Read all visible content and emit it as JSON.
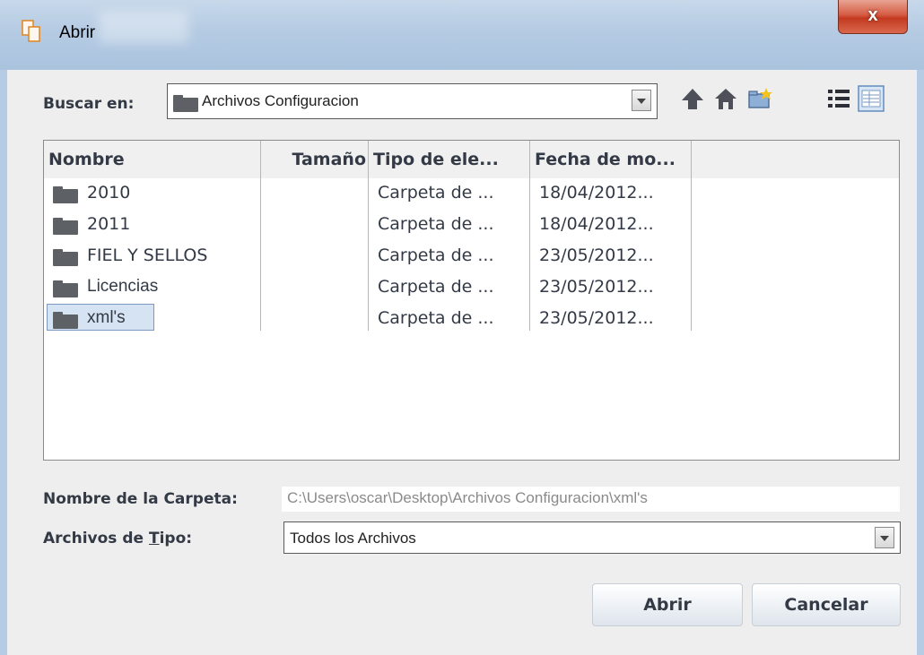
{
  "window": {
    "title": "Abrir",
    "close_label": "x"
  },
  "lookin": {
    "label": "Buscar en:",
    "value": "Archivos Configuracion"
  },
  "toolbar": {
    "up": "up-arrow-icon",
    "home": "home-icon",
    "new_folder": "new-folder-icon",
    "list_view": "list-view-icon",
    "details_view": "details-view-icon"
  },
  "columns": [
    "Nombre",
    "Tamaño",
    "Tipo de ele...",
    "Fecha de mo..."
  ],
  "rows": [
    {
      "name": "2010",
      "size": "",
      "type": "Carpeta de ...",
      "date": "18/04/2012..."
    },
    {
      "name": "2011",
      "size": "",
      "type": "Carpeta de ...",
      "date": "18/04/2012..."
    },
    {
      "name": "FIEL Y SELLOS",
      "size": "",
      "type": "Carpeta de ...",
      "date": "23/05/2012..."
    },
    {
      "name": "Licencias",
      "size": "",
      "type": "Carpeta de ...",
      "date": "23/05/2012..."
    },
    {
      "name": "xml's",
      "size": "",
      "type": "Carpeta de ...",
      "date": "23/05/2012..."
    }
  ],
  "folder_name": {
    "label": "Nombre de la Carpeta:",
    "value": "C:\\Users\\oscar\\Desktop\\Archivos Configuracion\\xml's"
  },
  "file_type": {
    "label_pre": "Archivos de ",
    "label_mnemonic": "T",
    "label_post": "ipo:",
    "value": "Todos los Archivos"
  },
  "buttons": {
    "open": "Abrir",
    "cancel": "Cancelar"
  },
  "colors": {
    "selection": "#d5e3f2",
    "text": "#333a46",
    "close": "#c23a20"
  }
}
